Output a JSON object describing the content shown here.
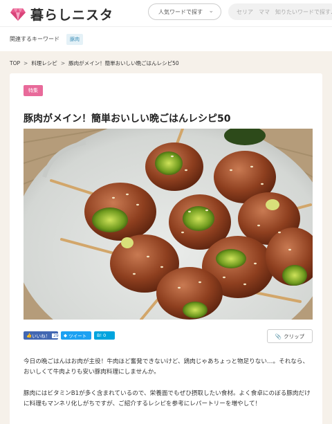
{
  "header": {
    "logo_text": "暮らしニスタ",
    "search_select": "人気ワードで探す",
    "search_placeholder": "セリア　ママ　知りたいワードで探す♪"
  },
  "keyword_bar": {
    "label": "関連するキーワード",
    "tags": [
      "豚肉"
    ]
  },
  "breadcrumb": [
    "TOP",
    "料理レシピ",
    "豚肉がメイン！簡単おいしい晩ごはんレシピ50"
  ],
  "article": {
    "badge": "特集",
    "title": "豚肉がメイン！簡単おいしい晩ごはんレシピ50",
    "photo_icon": "pork-rolls-food-photo",
    "share": {
      "facebook_label": "いいね！",
      "facebook_count": "29",
      "twitter_label": "ツイート",
      "hatena_label": "B!",
      "hatena_count": "0"
    },
    "clip_label": "クリップ",
    "paragraphs": [
      "今日の晩ごはんはお肉が主役！牛肉ほど奮発できないけど、鶏肉じゃあちょっと物足りない…。それなら、おいしくて牛肉よりも安い豚肉料理にしませんか。",
      "豚肉にはビタミンB1が多く含まれているので、栄養面でもぜひ摂取したい食材。よく食卓にのぼる豚肉だけに料理もマンネリ化しがちですが、ご紹介するレシピを参考にレパートリーを増やして！"
    ]
  },
  "colors": {
    "badge": "#e86a9a",
    "logo_gem": "#e8588c",
    "facebook": "#4267b2",
    "twitter": "#1da1f2",
    "hatena": "#00a4de"
  }
}
